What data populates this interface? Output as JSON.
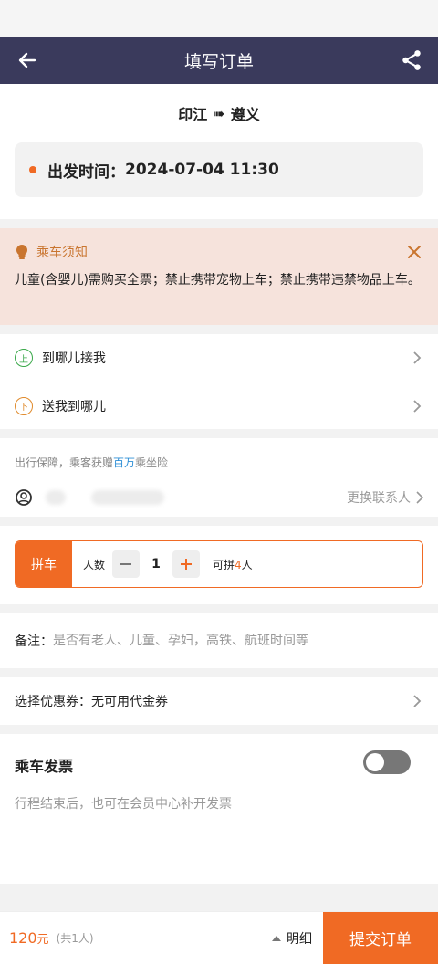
{
  "header": {
    "title": "填写订单"
  },
  "route": {
    "from": "印江",
    "arrow": "➠",
    "to": "遵义"
  },
  "departure": {
    "label": "出发时间：",
    "value": "2024-07-04 11:30"
  },
  "notice": {
    "title": "乘车须知",
    "text": "儿童(含婴儿)需购买全票；禁止携带宠物上车；禁止携带违禁物品上车。"
  },
  "locations": [
    {
      "badge": "上",
      "label": "到哪儿接我"
    },
    {
      "badge": "下",
      "label": "送我到哪儿"
    }
  ],
  "insurance": {
    "prefix": "出行保障，乘客获赠",
    "highlight": "百万",
    "suffix": "乘坐险",
    "change_contact": "更换联系人"
  },
  "carpool": {
    "tag": "拼车",
    "people_label": "人数",
    "count": "1",
    "capacity_prefix": "可拼",
    "capacity_num": "4",
    "capacity_suffix": "人"
  },
  "remark": {
    "label": "备注：",
    "placeholder": "是否有老人、儿童、孕妇，高铁、航班时间等"
  },
  "coupon": {
    "label": "选择优惠券：",
    "value": "无可用代金券"
  },
  "invoice": {
    "title": "乘车发票",
    "hint": "行程结束后，也可在会员中心补开发票",
    "enabled": false
  },
  "footer": {
    "price": "120",
    "unit": "元",
    "count_note": "(共1人)",
    "detail": "明细",
    "submit": "提交订单"
  },
  "colors": {
    "accent": "#f06a24",
    "header": "#3a3a5c",
    "notice_bg": "#f6e3dc"
  }
}
